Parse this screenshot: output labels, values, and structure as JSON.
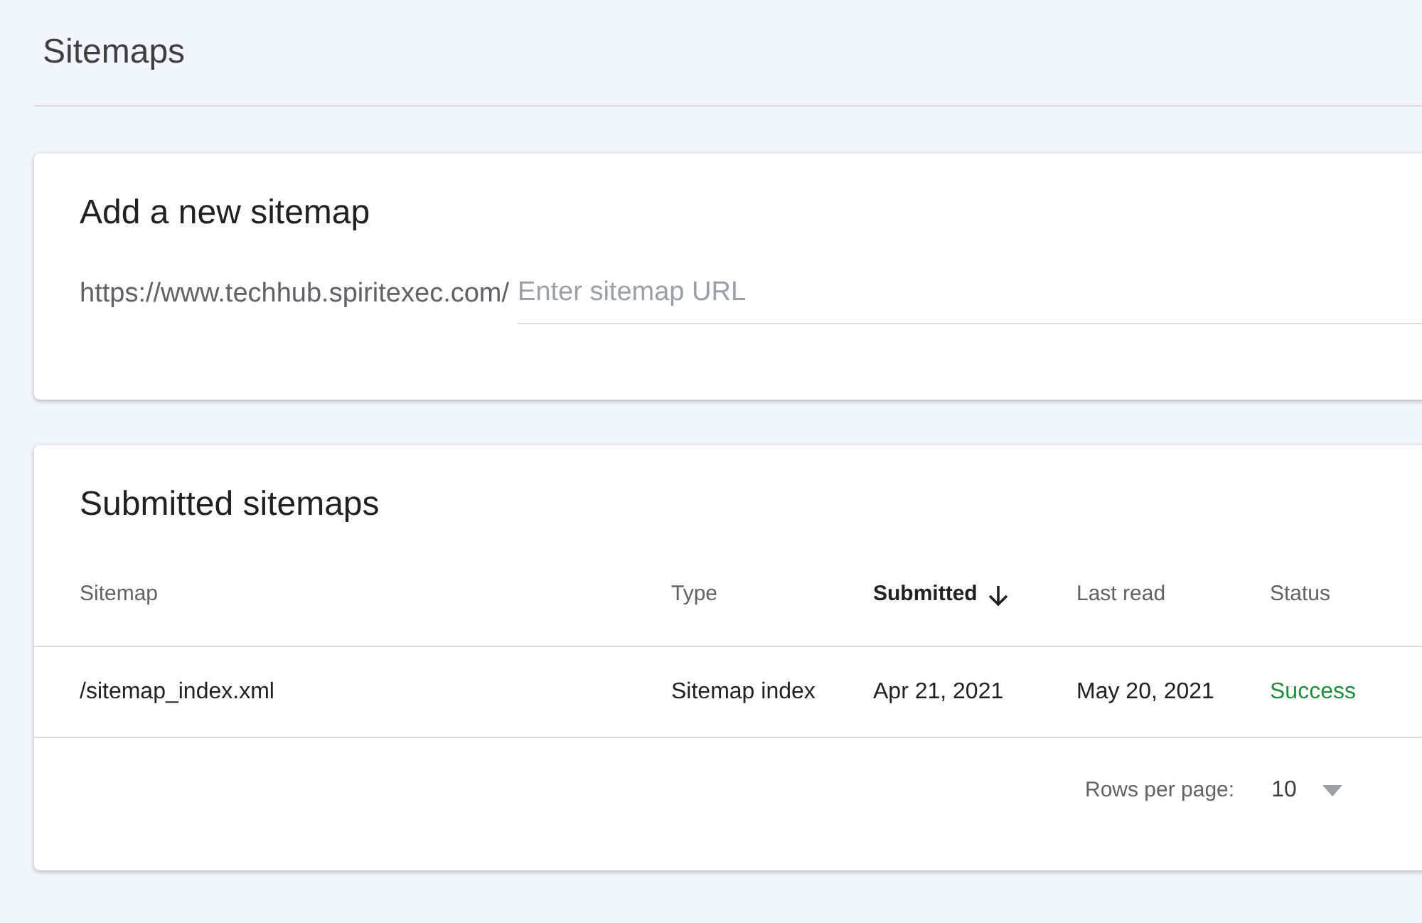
{
  "page_title": "Sitemaps",
  "add_card": {
    "title": "Add a new sitemap",
    "prefix": "https://www.techhub.spiritexec.com/",
    "placeholder": "Enter sitemap URL"
  },
  "submitted_card": {
    "title": "Submitted sitemaps",
    "columns": [
      {
        "label": "Sitemap",
        "sorted": false
      },
      {
        "label": "Type",
        "sorted": false
      },
      {
        "label": "Submitted",
        "sorted": true
      },
      {
        "label": "Last read",
        "sorted": false
      },
      {
        "label": "Status",
        "sorted": false
      }
    ],
    "rows": [
      {
        "sitemap": "/sitemap_index.xml",
        "type": "Sitemap index",
        "submitted": "Apr 21, 2021",
        "last_read": "May 20, 2021",
        "status": "Success",
        "color": "#1e8e3e"
      }
    ],
    "footer": {
      "rows_label": "Rows per page:",
      "rows_value": "10"
    }
  }
}
